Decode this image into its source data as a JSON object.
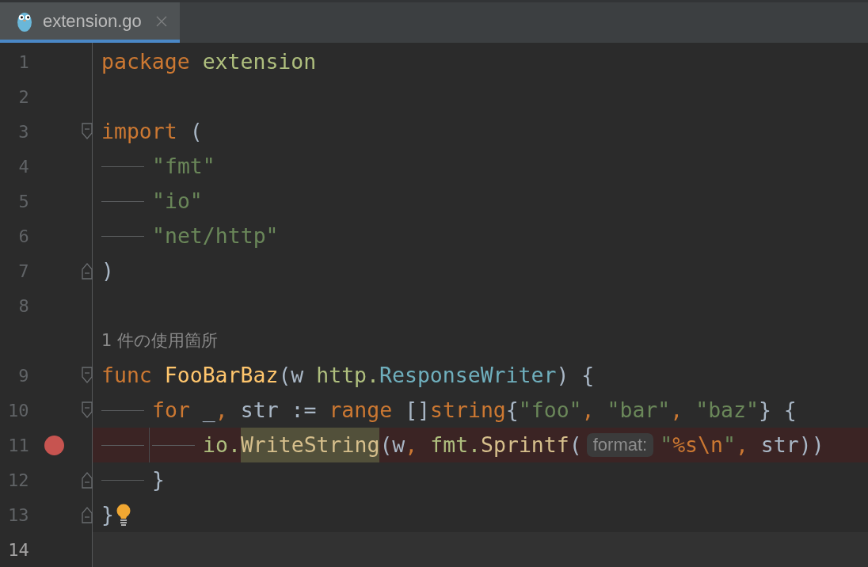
{
  "tabs": [
    {
      "label": "extension.go",
      "selected": true,
      "closable": true
    }
  ],
  "lines": [
    {
      "kind": "code",
      "number": "1",
      "fold_start": false,
      "fold_end": false,
      "breakpoint": false,
      "current": false,
      "intention": false,
      "tokens": [
        {
          "kind": "keyword",
          "text": "package "
        },
        {
          "kind": "package",
          "text": "extension"
        }
      ]
    },
    {
      "kind": "code",
      "number": "2",
      "fold_start": false,
      "fold_end": false,
      "breakpoint": false,
      "current": false,
      "intention": false
    },
    {
      "kind": "code",
      "number": "3",
      "fold_start": true,
      "fold_end": false,
      "breakpoint": false,
      "current": false,
      "intention": false,
      "tokens": [
        {
          "kind": "keyword",
          "text": "import "
        },
        {
          "kind": "plain",
          "text": "("
        }
      ]
    },
    {
      "kind": "code",
      "number": "4",
      "fold_start": false,
      "fold_end": false,
      "breakpoint": false,
      "current": false,
      "intention": false,
      "tokens": [
        {
          "kind": "indent"
        },
        {
          "kind": "string",
          "text": "\"fmt\""
        }
      ]
    },
    {
      "kind": "code",
      "number": "5",
      "fold_start": false,
      "fold_end": false,
      "breakpoint": false,
      "current": false,
      "intention": false,
      "tokens": [
        {
          "kind": "indent"
        },
        {
          "kind": "string",
          "text": "\"io\""
        }
      ]
    },
    {
      "kind": "code",
      "number": "6",
      "fold_start": false,
      "fold_end": false,
      "breakpoint": false,
      "current": false,
      "intention": false,
      "tokens": [
        {
          "kind": "indent"
        },
        {
          "kind": "string",
          "text": "\"net/http\""
        }
      ]
    },
    {
      "kind": "code",
      "number": "7",
      "fold_start": false,
      "fold_end": true,
      "breakpoint": false,
      "current": false,
      "intention": false,
      "tokens": [
        {
          "kind": "plain",
          "text": ")"
        }
      ]
    },
    {
      "kind": "code",
      "number": "8",
      "fold_start": false,
      "fold_end": false,
      "breakpoint": false,
      "current": false,
      "intention": false
    },
    {
      "kind": "usage",
      "text": "1 件の使用箇所"
    },
    {
      "kind": "code",
      "number": "9",
      "fold_start": true,
      "fold_end": false,
      "breakpoint": false,
      "current": false,
      "intention": false,
      "tokens": [
        {
          "kind": "keyword",
          "text": "func "
        },
        {
          "kind": "function",
          "text": "FooBarBaz"
        },
        {
          "kind": "plain",
          "text": "(w "
        },
        {
          "kind": "package",
          "text": "http."
        },
        {
          "kind": "type",
          "text": "ResponseWriter"
        },
        {
          "kind": "plain",
          "text": ") {"
        }
      ]
    },
    {
      "kind": "code",
      "number": "10",
      "fold_start": true,
      "fold_end": false,
      "breakpoint": false,
      "current": false,
      "intention": false,
      "tokens": [
        {
          "kind": "indent"
        },
        {
          "kind": "keyword",
          "text": "for "
        },
        {
          "kind": "plain",
          "text": "_"
        },
        {
          "kind": "keyword",
          "text": ", "
        },
        {
          "kind": "plain",
          "text": "str := "
        },
        {
          "kind": "keyword",
          "text": "range "
        },
        {
          "kind": "plain",
          "text": "[]"
        },
        {
          "kind": "keyword",
          "text": "string"
        },
        {
          "kind": "plain",
          "text": "{"
        },
        {
          "kind": "string",
          "text": "\"foo\""
        },
        {
          "kind": "keyword",
          "text": ", "
        },
        {
          "kind": "string",
          "text": "\"bar\""
        },
        {
          "kind": "keyword",
          "text": ", "
        },
        {
          "kind": "string",
          "text": "\"baz\""
        },
        {
          "kind": "plain",
          "text": "} {"
        }
      ]
    },
    {
      "kind": "code",
      "number": "11",
      "fold_start": false,
      "fold_end": false,
      "breakpoint": true,
      "current": false,
      "intention": false,
      "tokens": [
        {
          "kind": "indent"
        },
        {
          "kind": "indent"
        },
        {
          "kind": "package",
          "text": "io."
        },
        {
          "kind": "call-highlighted",
          "text": "WriteString"
        },
        {
          "kind": "plain",
          "text": "(w"
        },
        {
          "kind": "keyword",
          "text": ", "
        },
        {
          "kind": "package",
          "text": "fmt."
        },
        {
          "kind": "call",
          "text": "Sprintf"
        },
        {
          "kind": "plain",
          "text": "("
        },
        {
          "kind": "hint",
          "text": "format:"
        },
        {
          "kind": "string",
          "text": "\""
        },
        {
          "kind": "keyword",
          "text": "%s\\n"
        },
        {
          "kind": "string",
          "text": "\""
        },
        {
          "kind": "keyword",
          "text": ", "
        },
        {
          "kind": "plain",
          "text": "str))"
        }
      ]
    },
    {
      "kind": "code",
      "number": "12",
      "fold_start": false,
      "fold_end": true,
      "breakpoint": false,
      "current": false,
      "intention": false,
      "tokens": [
        {
          "kind": "indent"
        },
        {
          "kind": "plain",
          "text": "}"
        }
      ]
    },
    {
      "kind": "code",
      "number": "13",
      "fold_start": false,
      "fold_end": true,
      "breakpoint": false,
      "current": false,
      "intention": true,
      "tokens": [
        {
          "kind": "plain",
          "text": "}"
        }
      ]
    },
    {
      "kind": "code",
      "number": "14",
      "fold_start": false,
      "fold_end": false,
      "breakpoint": false,
      "current": true,
      "intention": false
    }
  ]
}
